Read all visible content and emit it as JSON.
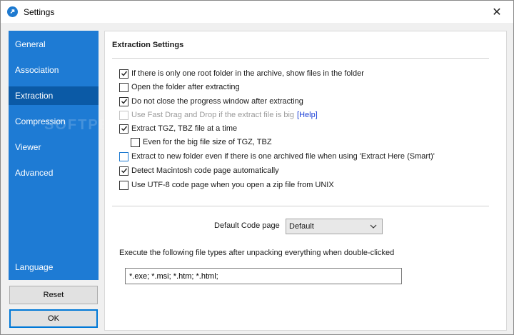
{
  "window": {
    "title": "Settings",
    "close_glyph": "✕"
  },
  "sidebar": {
    "watermark": "SOFTPEDIA",
    "items": [
      {
        "label": "General"
      },
      {
        "label": "Association"
      },
      {
        "label": "Extraction",
        "active": true
      },
      {
        "label": "Compression"
      },
      {
        "label": "Viewer"
      },
      {
        "label": "Advanced"
      }
    ],
    "language": "Language"
  },
  "buttons": {
    "reset": "Reset",
    "ok": "OK"
  },
  "extraction": {
    "title": "Extraction Settings",
    "options": [
      {
        "label": "If there is only one root folder in the archive, show files in the folder",
        "checked": true
      },
      {
        "label": "Open the folder after extracting",
        "checked": false
      },
      {
        "label": "Do not close the progress window after extracting",
        "checked": true
      },
      {
        "label": "Use Fast Drag and Drop if the extract file is big",
        "checked": false,
        "disabled": true,
        "link": "[Help]"
      },
      {
        "label": "Extract TGZ, TBZ file at a time",
        "checked": true
      },
      {
        "label": "Even for the big file size of TGZ, TBZ",
        "checked": false
      },
      {
        "label": "Extract to new folder even if there is one archived file when using 'Extract Here (Smart)'",
        "checked": false
      },
      {
        "label": "Detect Macintosh code page automatically",
        "checked": true
      },
      {
        "label": "Use UTF-8 code page when you open a zip file from UNIX",
        "checked": false
      }
    ],
    "code_page_label": "Default Code page",
    "code_page_value": "Default",
    "exec_label": "Execute the following file types after unpacking everything when double-clicked",
    "exec_value": "*.exe; *.msi; *.htm; *.html;"
  },
  "colors": {
    "sidebar": "#1e7bd4",
    "sidebar_active": "#0b5aa6",
    "accent": "#0078d7"
  },
  "icons": {
    "app": "bandizip-icon",
    "close": "close-icon",
    "check": "checkmark-icon",
    "dropdown": "chevron-down-icon"
  }
}
